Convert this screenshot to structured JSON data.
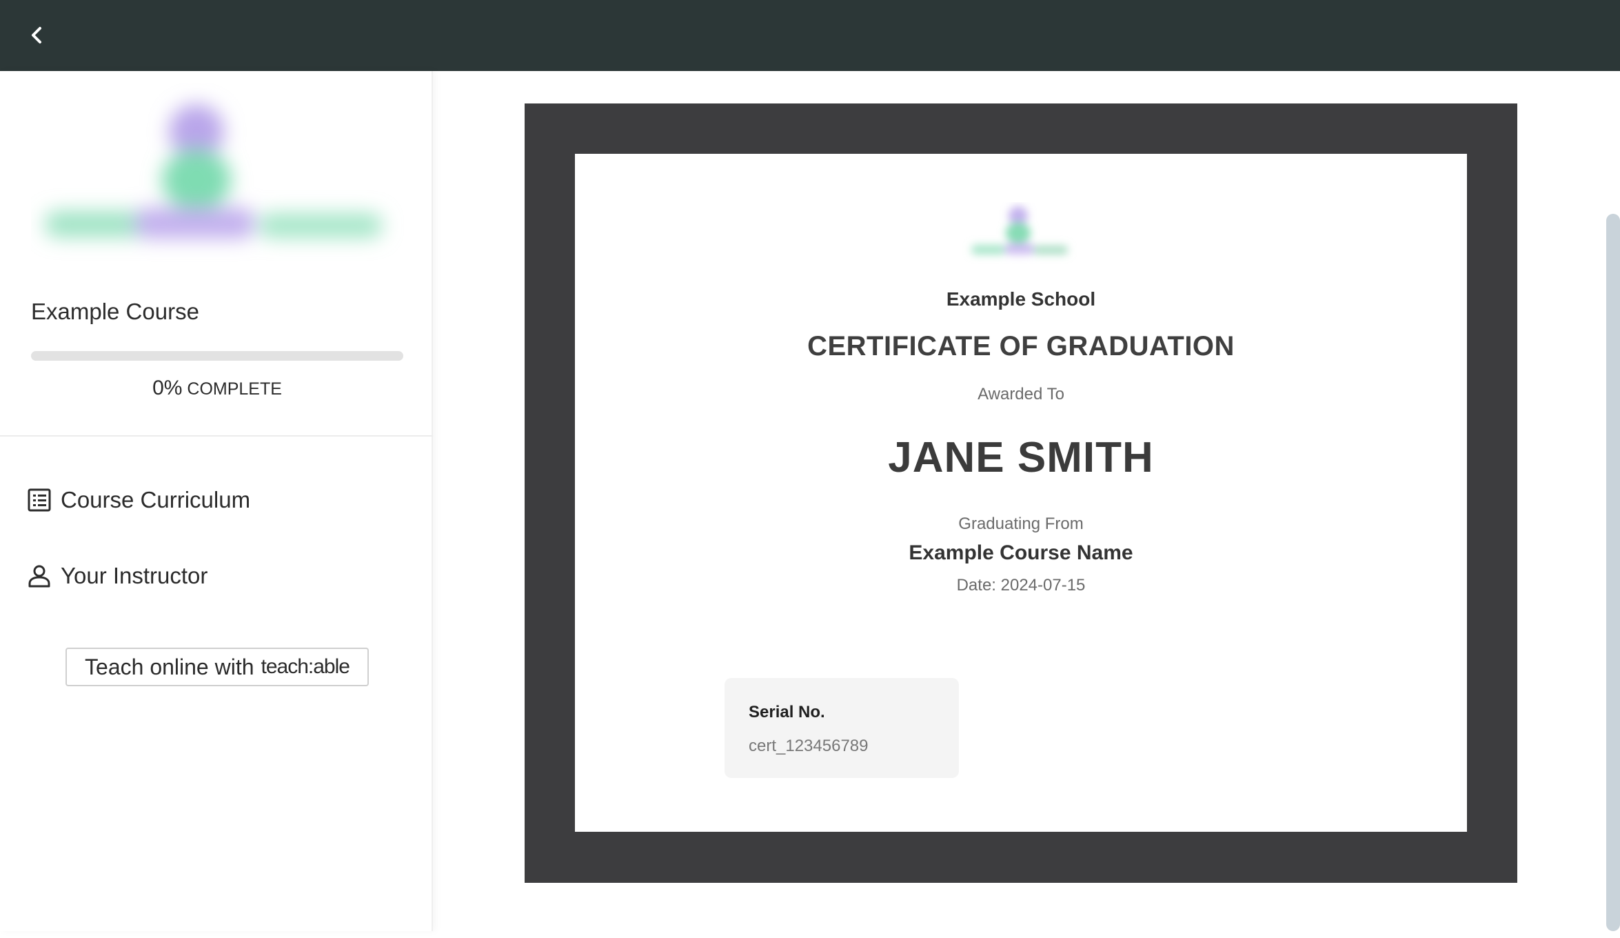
{
  "topbar": {
    "back_icon": "chevron-left-icon",
    "background": "#2c3737"
  },
  "sidebar": {
    "course_title": "Example Course",
    "progress": {
      "percent_value": 0,
      "percent_label": "0%",
      "complete_label": "COMPLETE",
      "accent": "#43c792"
    },
    "nav": [
      {
        "label": "Course Curriculum",
        "icon": "list-icon"
      },
      {
        "label": "Your Instructor",
        "icon": "user-icon"
      }
    ],
    "teach_button": {
      "prefix": "Teach online with",
      "brand": "teach:able"
    }
  },
  "certificate": {
    "school": "Example School",
    "heading": "CERTIFICATE OF GRADUATION",
    "awarded_label": "Awarded To",
    "recipient": "JANE SMITH",
    "graduating_label": "Graduating From",
    "course_name": "Example Course Name",
    "date": "Date: 2024-07-15",
    "serial_label": "Serial No.",
    "serial_value": "cert_123456789",
    "frame_color": "#3d3d3f"
  }
}
